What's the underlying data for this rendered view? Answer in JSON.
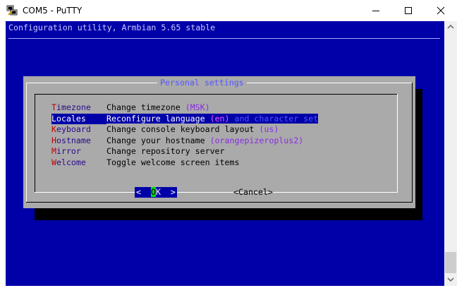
{
  "window": {
    "title": "COM5 - PuTTY",
    "icon": "putty-icon",
    "controls": [
      "minimize-icon",
      "maximize-icon",
      "close-icon"
    ]
  },
  "terminal": {
    "header": "Configuration utility, Armbian 5.65 stable",
    "colors": {
      "background": "#0000a8",
      "dialog": "#aaaaaa",
      "selection": "#0000a8",
      "hotkey": "#c00000",
      "accent": "#8a2be2"
    }
  },
  "dialog": {
    "title": "Personal settings",
    "items": [
      {
        "hot": "T",
        "rest": "imezone",
        "desc_a": "Change timezone ",
        "desc_b": "(MSK)",
        "desc_c": "",
        "selected": false
      },
      {
        "hot": "L",
        "rest": "ocales",
        "desc_a": "Reconfigure language ",
        "desc_b": "(en)",
        "desc_c": " and character set",
        "selected": true
      },
      {
        "hot": "K",
        "rest": "eyboard",
        "desc_a": "Change console keyboard layout ",
        "desc_b": "(us)",
        "desc_c": "",
        "selected": false
      },
      {
        "hot": "H",
        "rest": "ostname",
        "desc_a": "Change your hostname ",
        "desc_b": "(orangepizeroplus2)",
        "desc_c": "",
        "selected": false
      },
      {
        "hot": "M",
        "rest": "irror",
        "desc_a": "Change repository server",
        "desc_b": "",
        "desc_c": "",
        "selected": false
      },
      {
        "hot": "W",
        "rest": "elcome",
        "desc_a": "Toggle welcome screen items",
        "desc_b": "",
        "desc_c": "",
        "selected": false
      }
    ],
    "ok": {
      "left": "<  ",
      "cursor": "O",
      "rest": "K  >"
    },
    "cancel": "<Cancel>"
  }
}
